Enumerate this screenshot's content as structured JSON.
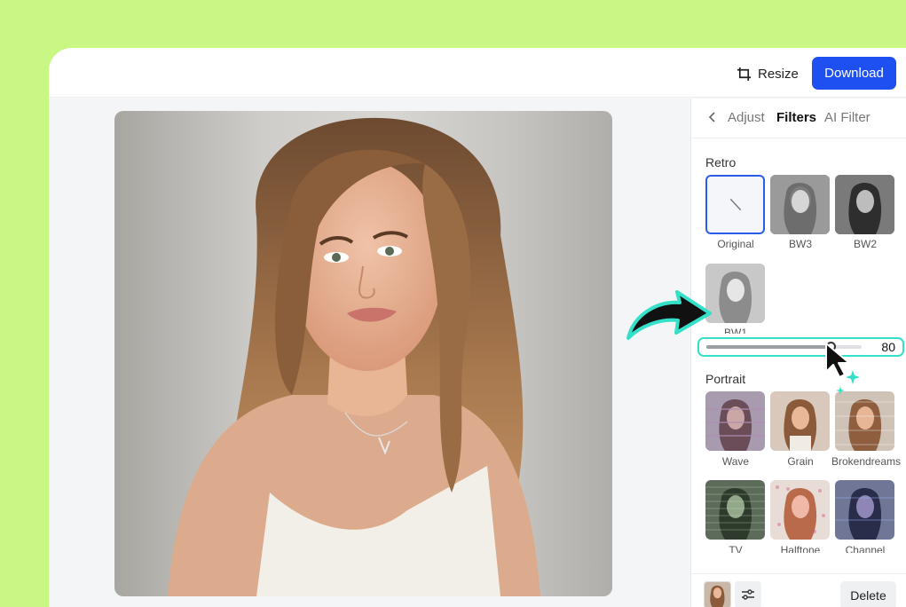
{
  "header": {
    "resize_label": "Resize",
    "download_label": "Download",
    "accent_color": "#1e4ff0"
  },
  "panel": {
    "tabs": [
      {
        "label": "Adjust",
        "active": false
      },
      {
        "label": "Filters",
        "active": true
      },
      {
        "label": "AI Filter",
        "active": false
      }
    ],
    "sections": [
      {
        "title": "Retro",
        "filters": [
          {
            "label": "Original",
            "selected": true
          },
          {
            "label": "BW3"
          },
          {
            "label": "BW2"
          },
          {
            "label": "BW1"
          }
        ]
      },
      {
        "title": "Portrait",
        "filters": [
          {
            "label": "Wave"
          },
          {
            "label": "Grain"
          },
          {
            "label": "Brokendreams"
          },
          {
            "label": "TV"
          },
          {
            "label": "Halftone"
          },
          {
            "label": "Channel"
          }
        ]
      }
    ],
    "intensity_value": "80",
    "intensity_fraction": 0.8,
    "delete_label": "Delete"
  },
  "colors": {
    "background": "#c8f784",
    "highlight": "#34e0c8",
    "selected_border": "#2a5ee8"
  },
  "icons": [
    "crop-icon",
    "chevron-left-icon",
    "sliders-icon",
    "curved-arrow-icon",
    "pointer-cursor-icon",
    "sparkle-icon"
  ]
}
